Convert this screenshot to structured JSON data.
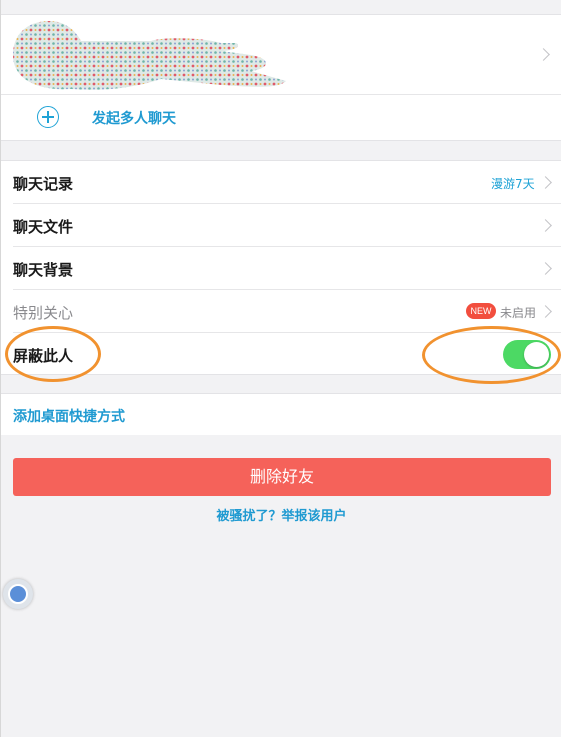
{
  "profile": {
    "name_obscured": true,
    "chevron_icon": "chevron-right-icon"
  },
  "multi_chat": {
    "label": "发起多人聊天",
    "icon": "plus-circle-icon"
  },
  "settings": {
    "items": [
      {
        "label": "聊天记录",
        "value": "漫游7天",
        "value_color": "#1fa3d6"
      },
      {
        "label": "聊天文件",
        "value": ""
      },
      {
        "label": "聊天背景",
        "value": ""
      },
      {
        "label": "特别关心",
        "badge": "NEW",
        "value": "未启用"
      },
      {
        "label": "屏蔽此人",
        "toggle": true
      }
    ]
  },
  "shortcut": {
    "label": "添加桌面快捷方式"
  },
  "actions": {
    "delete_label": "删除好友",
    "report_label": "被骚扰了？举报该用户"
  },
  "colors": {
    "accent": "#1fa3d6",
    "danger": "#f5625a",
    "toggle_on": "#4cd964",
    "badge": "#f24e3e",
    "annotation": "#f1922f"
  }
}
